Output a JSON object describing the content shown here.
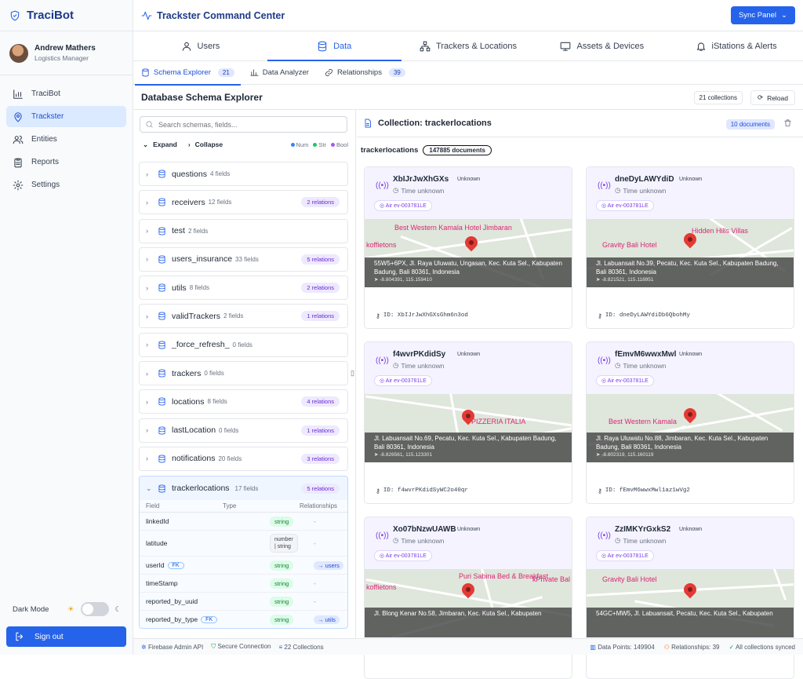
{
  "brand": {
    "name": "TraciBot"
  },
  "user": {
    "name": "Andrew Mathers",
    "role": "Logistics Manager"
  },
  "nav": [
    {
      "label": "TraciBot",
      "icon": "chart-icon"
    },
    {
      "label": "Trackster",
      "icon": "location-icon",
      "active": true
    },
    {
      "label": "Entities",
      "icon": "users-icon"
    },
    {
      "label": "Reports",
      "icon": "clipboard-icon"
    },
    {
      "label": "Settings",
      "icon": "gear-icon"
    }
  ],
  "dark_mode": {
    "label": "Dark Mode",
    "enabled": false
  },
  "signout": {
    "label": "Sign out"
  },
  "header": {
    "title": "Trackster Command Center",
    "sync_label": "Sync Panel"
  },
  "main_tabs": [
    "Users",
    "Data",
    "Trackers & Locations",
    "Assets & Devices",
    "iStations & Alerts"
  ],
  "sub_tabs": [
    {
      "label": "Schema Explorer",
      "count": "21"
    },
    {
      "label": "Data Analyzer",
      "count": ""
    },
    {
      "label": "Relationships",
      "count": "39"
    }
  ],
  "explorer": {
    "title": "Database Schema Explorer",
    "collections_count": "21 collections",
    "reload": "Reload"
  },
  "search": {
    "placeholder": "Search schemas, fields..."
  },
  "expand_controls": {
    "expand": "Expand",
    "collapse": "Collapse",
    "legend": [
      "Num",
      "Str",
      "Bool"
    ]
  },
  "collections": [
    {
      "name": "questions",
      "fields": "4 fields",
      "relations": ""
    },
    {
      "name": "receivers",
      "fields": "12 fields",
      "relations": "2 relations"
    },
    {
      "name": "test",
      "fields": "2 fields",
      "relations": ""
    },
    {
      "name": "users_insurance",
      "fields": "33 fields",
      "relations": "5 relations"
    },
    {
      "name": "utils",
      "fields": "8 fields",
      "relations": "2 relations"
    },
    {
      "name": "validTrackers",
      "fields": "2 fields",
      "relations": "1 relations"
    },
    {
      "name": "_force_refresh_",
      "fields": "0 fields",
      "relations": ""
    },
    {
      "name": "trackers",
      "fields": "0 fields",
      "relations": ""
    },
    {
      "name": "locations",
      "fields": "8 fields",
      "relations": "4 relations"
    },
    {
      "name": "lastLocation",
      "fields": "0 fields",
      "relations": "1 relations"
    },
    {
      "name": "notifications",
      "fields": "20 fields",
      "relations": "3 relations"
    }
  ],
  "expanded": {
    "name": "trackerlocations",
    "fields": "17 fields",
    "relations": "5 relations",
    "headers": [
      "Field",
      "Type",
      "Relationships"
    ],
    "rows": [
      {
        "field": "linkedId",
        "type": "string",
        "fk": "",
        "rel": "-"
      },
      {
        "field": "latitude",
        "type": "number | string",
        "fk": "",
        "rel": "-"
      },
      {
        "field": "userId",
        "type": "string",
        "fk": "FK",
        "rel": "→ users"
      },
      {
        "field": "timeStamp",
        "type": "string",
        "fk": "",
        "rel": "-"
      },
      {
        "field": "reported_by_uuid",
        "type": "string",
        "fk": "",
        "rel": "-"
      },
      {
        "field": "reported_by_type",
        "type": "string",
        "fk": "FK",
        "rel": "→ utils"
      }
    ]
  },
  "collection_panel": {
    "title": "Collection: trackerlocations",
    "documents": "10 documents",
    "name": "trackerlocations",
    "total": "147885 documents"
  },
  "cards": [
    {
      "id": "XbIJrJwXhGXs",
      "status": "Unknown",
      "time": "Time unknown",
      "tag": "Air ev-003781LE",
      "address": "55W5+6PX, Jl. Raya Uluwatu, Ungasan, Kec. Kuta Sel., Kabupaten Badung, Bali 80361, Indonesia",
      "coords": "-8.804391, 115.159410",
      "full_id": "ID: XbIJrJwXhGXsGhm6n3od",
      "pois": [
        "Best Western Kamala Hotel Jimbaran",
        "koffietons"
      ]
    },
    {
      "id": "dneDyLAWYdiD",
      "status": "Unknown",
      "time": "Time unknown",
      "tag": "Air ev-003781LE",
      "address": "Jl. Labuansait No.39, Pecatu, Kec. Kuta Sel., Kabupaten Badung, Bali 80361, Indonesia",
      "coords": "-8.821521, 115.118951",
      "full_id": "ID: dneDyLAWYdiDb6QbohMy",
      "pois": [
        "Gravity Bali Hotel",
        "Hidden Hills Villas"
      ]
    },
    {
      "id": "f4wvrPKdidSy",
      "status": "Unknown",
      "time": "Time unknown",
      "tag": "Air ev-003781LE",
      "address": "Jl. Labuansait No.69, Pecatu, Kec. Kuta Sel., Kabupaten Badung, Bali 80361, Indonesia",
      "coords": "-8.826561, 115.123301",
      "full_id": "ID: f4wvrPKdidSyWC2o40qr",
      "pois": [
        "PIZZERIA ITALIA"
      ]
    },
    {
      "id": "fEmvM6wwxMwl",
      "status": "Unknown",
      "time": "Time unknown",
      "tag": "Air ev-003781LE",
      "address": "Jl. Raya Uluwatu No.88, Jimbaran, Kec. Kuta Sel., Kabupaten Badung, Bali 80361, Indonesia",
      "coords": "-8.802319, 115.160119",
      "full_id": "ID: fEmvM6wwxMwl1az1wVg2",
      "pois": [
        "Best Western Kamala"
      ]
    },
    {
      "id": "Xo07bNzwUAWB",
      "status": "Unknown",
      "time": "Time unknown",
      "tag": "Air ev-003781LE",
      "address": "Jl. Blong Kenar No.58, Jimbaran, Kec. Kuta Sel., Kabupaten",
      "coords": "",
      "full_id": "",
      "pois": [
        "Puri Sabina Bed & Breakfast",
        "koffietons",
        "kPrivate Balangan Cool Adults Only"
      ]
    },
    {
      "id": "ZzIMKYrGxkS2",
      "status": "Unknown",
      "time": "Time unknown",
      "tag": "Air ev-003781LE",
      "address": "54GC+MW5, Jl. Labuansait, Pecatu, Kec. Kuta Sel., Kabupaten",
      "coords": "",
      "full_id": "",
      "pois": [
        "Gravity Bali Hotel"
      ]
    }
  ],
  "status": {
    "api": "Firebase Admin API",
    "secure": "Secure Connection",
    "collections": "22 Collections",
    "points": "Data Points: 149904",
    "relationships": "Relationships: 39",
    "synced": "All collections synced"
  }
}
